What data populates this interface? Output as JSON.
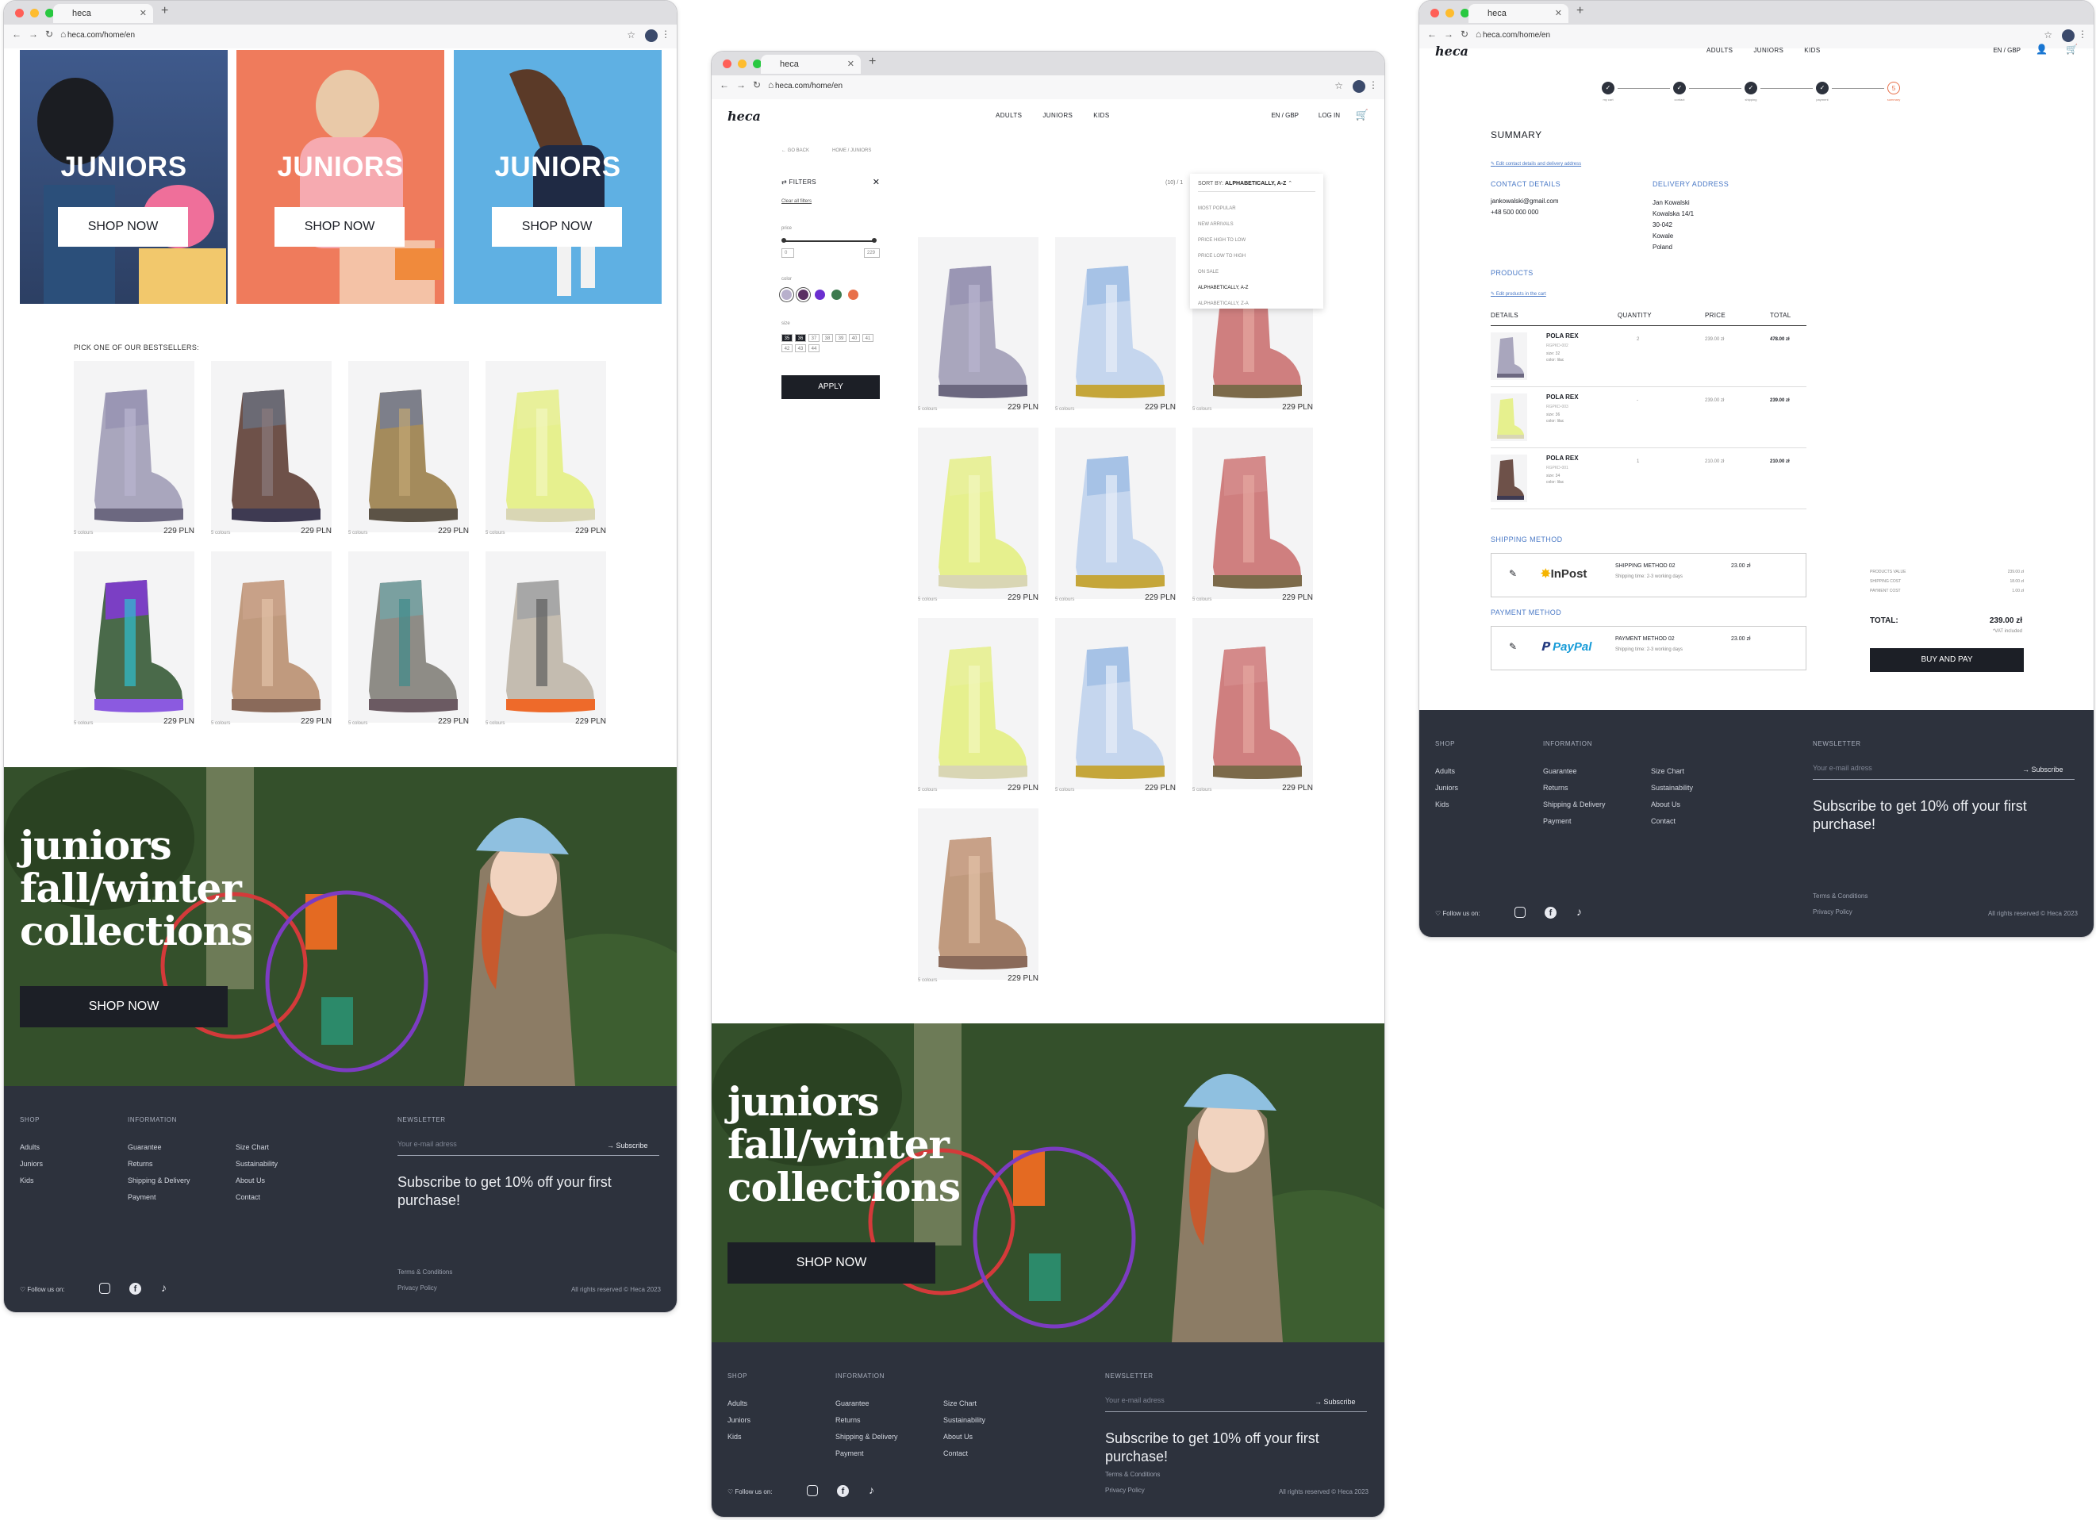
{
  "home": {
    "tab_title": "heca",
    "url": "heca.com/home/en",
    "heroes": [
      {
        "label": "JUNIORS",
        "button": "SHOP NOW"
      },
      {
        "label": "JUNIORS",
        "button": "SHOP NOW"
      },
      {
        "label": "JUNIORS",
        "button": "SHOP NOW"
      }
    ],
    "bestsellers_title": "PICK ONE OF OUR BESTSELLERS:",
    "products": [
      {
        "colors": "5 colours",
        "price": "229 PLN"
      },
      {
        "colors": "5 colours",
        "price": "229 PLN"
      },
      {
        "colors": "5 colours",
        "price": "229 PLN"
      },
      {
        "colors": "5 colours",
        "price": "229 PLN"
      },
      {
        "colors": "5 colours",
        "price": "229 PLN"
      },
      {
        "colors": "5 colours",
        "price": "229 PLN"
      },
      {
        "colors": "5 colours",
        "price": "229 PLN"
      },
      {
        "colors": "5 colours",
        "price": "229 PLN"
      }
    ],
    "promo": {
      "line1": "juniors",
      "line2": "fall/winter",
      "line3": "collections",
      "button": "SHOP NOW"
    }
  },
  "listing": {
    "tab_title": "heca",
    "url": "heca.com/home/en",
    "logo": "heca",
    "nav": [
      "ADULTS",
      "JUNIORS",
      "KIDS"
    ],
    "lang": "EN / GBP",
    "login": "LOG IN",
    "go_back": "GO BACK",
    "breadcrumb": "HOME / JUNIORS",
    "filters": {
      "title": "FILTERS",
      "clear": "Clear all filters",
      "price_label": "price",
      "price_min": "0",
      "price_max": "229",
      "color_label": "color",
      "colors": [
        "#b8b0cc",
        "#5a2f63",
        "#6b2fd0",
        "#3d7a4f",
        "#e8704a"
      ],
      "size_label": "size",
      "sizes": [
        "35",
        "36",
        "37",
        "38",
        "39",
        "40",
        "41",
        "42",
        "43",
        "44"
      ],
      "apply": "APPLY"
    },
    "count": "(10) / 1",
    "sort": {
      "label": "SORT BY:",
      "value": "ALPHABETICALLY, A-Z",
      "options": [
        "MOST POPULAR",
        "NEW ARRIVALS",
        "PRICE HIGH TO LOW",
        "PRICE LOW TO HIGH",
        "ON SALE",
        "ALPHABETICALLY, A-Z",
        "ALPHABETICALLY, Z-A"
      ]
    },
    "products": [
      {
        "colors": "5 colours",
        "price": "229 PLN"
      },
      {
        "colors": "5 colours",
        "price": "229 PLN"
      },
      {
        "colors": "5 colours",
        "price": "229 PLN"
      },
      {
        "colors": "5 colours",
        "price": "229 PLN"
      },
      {
        "colors": "5 colours",
        "price": "229 PLN"
      },
      {
        "colors": "5 colours",
        "price": "229 PLN"
      },
      {
        "colors": "5 colours",
        "price": "229 PLN"
      },
      {
        "colors": "5 colours",
        "price": "229 PLN"
      },
      {
        "colors": "5 colours",
        "price": "229 PLN"
      },
      {
        "colors": "5 colours",
        "price": "229 PLN"
      }
    ],
    "promo": {
      "line1": "juniors",
      "line2": "fall/winter",
      "line3": "collections",
      "button": "SHOP NOW"
    }
  },
  "checkout": {
    "tab_title": "heca",
    "url": "heca.com/home/en",
    "logo": "heca",
    "nav": [
      "ADULTS",
      "JUNIORS",
      "KIDS"
    ],
    "lang": "EN / GBP",
    "steps": [
      "my cart",
      "contact",
      "shipping",
      "payment",
      "summary"
    ],
    "summary_title": "SUMMARY",
    "edit_contact": "Edit contact details and delivery address",
    "contact_title": "CONTACT DETAILS",
    "contact_email": "jankowalski@gmail.com",
    "contact_phone": "+48 500 000 000",
    "delivery_title": "DELIVERY ADDRESS",
    "delivery_lines": [
      "Jan Kowalski",
      "Kowalska 14/1",
      "30-042",
      "Kowale",
      "Poland"
    ],
    "products_title": "PRODUCTS",
    "edit_products": "Edit products in the cart",
    "table_headers": [
      "DETAILS",
      "QUANTITY",
      "PRICE",
      "TOTAL"
    ],
    "items": [
      {
        "name": "POLA REX",
        "code": "RGPKD-002",
        "size": "size: 32",
        "color": "color: lilac",
        "qty": "2",
        "price": "239.00 zł",
        "total": "478.00 zł"
      },
      {
        "name": "POLA REX",
        "code": "RGPKD-003",
        "size": "size: 36",
        "color": "color: lilac",
        "qty": "-",
        "price": "239.00 zł",
        "total": "239.00 zł"
      },
      {
        "name": "POLA REX",
        "code": "RGPKD-001",
        "size": "size: 34",
        "color": "color: lilac",
        "qty": "1",
        "price": "210.00 zł",
        "total": "210.00 zł"
      }
    ],
    "shipping_title": "SHIPPING METHOD",
    "shipping": {
      "brand": "InPost",
      "name": "SHIPPING METHOD 02",
      "desc": "Shipping time: 2-3 working days",
      "price": "23.00 zł"
    },
    "payment_title": "PAYMENT METHOD",
    "payment": {
      "brand": "PayPal",
      "name": "PAYMENT METHOD 02",
      "desc": "Shipping time: 2-3 working days",
      "price": "23.00 zł"
    },
    "totals": [
      {
        "label": "PRODUCTS VALUE",
        "value": "239.00 zł"
      },
      {
        "label": "SHIPPING COST",
        "value": "18.00 zł"
      },
      {
        "label": "PAYMENT COST",
        "value": "1.00 zł"
      }
    ],
    "total_label": "TOTAL:",
    "total_value": "239.00 zł",
    "vat": "*VAT included",
    "buy": "BUY AND PAY"
  },
  "footer": {
    "shop_title": "SHOP",
    "shop": [
      "Adults",
      "Juniors",
      "Kids"
    ],
    "info_title": "INFORMATION",
    "info_col1": [
      "Guarantee",
      "Returns",
      "Shipping & Delivery",
      "Payment"
    ],
    "info_col2": [
      "Size Chart",
      "Sustainability",
      "About Us",
      "Contact"
    ],
    "newsletter_title": "NEWSLETTER",
    "email_placeholder": "Your e-mail adress",
    "subscribe": "Subscribe",
    "newsletter_text": "Subscribe to get 10% off your first purchase!",
    "follow": "Follow us on:",
    "terms": "Terms & Conditions",
    "privacy": "Privacy Policy",
    "rights": "All rights reserved © Heca 2023"
  },
  "colors": {
    "dark": "#2d323d",
    "accent_blue": "#4a79c6",
    "accent_orange": "#e8704a",
    "black": "#1c1f26"
  }
}
